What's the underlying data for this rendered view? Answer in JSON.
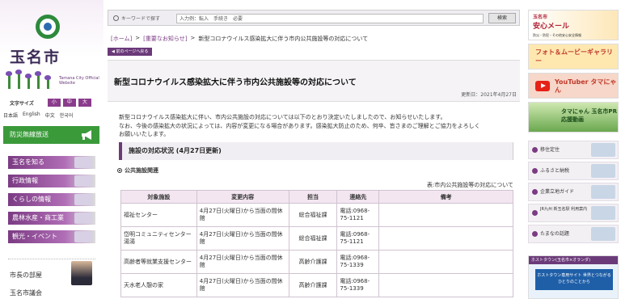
{
  "brand": {
    "city_name": "玉名市",
    "city_en": "Tamana City Official Website",
    "color_primary": "#6b3a79",
    "color_green": "#3a9a3a"
  },
  "left": {
    "font_size_label": "文字サイズ",
    "font_sizes": [
      "小",
      "中",
      "大"
    ],
    "languages": [
      "日本語",
      "English",
      "中文",
      "한국어"
    ],
    "bousai": "防災無線放送",
    "nav": [
      "玉名を知る",
      "行政情報",
      "くらしの情報",
      "農林水産・商工業",
      "観光・イベント"
    ],
    "mayor": "市長の部屋",
    "gikai": "玉名市議会"
  },
  "search": {
    "label": "キーワードで探す",
    "value": "入力例：転入　手続き　必要",
    "button": "検索"
  },
  "breadcrumb": [
    "[ホーム]",
    ">",
    "[重要なお知らせ]",
    ">",
    "新型コロナウイルス感染拡大に伴う市内公共施設等の対応について"
  ],
  "back_label": "前のページへ戻る",
  "page": {
    "title": "新型コロナウイルス感染拡大に伴う市内公共施設等の対応について",
    "updated": "更新日：2021年4月27日",
    "intro": [
      "新型コロナウイルス感染拡大に伴い、市内公共施設の対応については以下のとおり決定いたしましたので、お知らせいたします。",
      "なお、今後の感染拡大の状況によっては、内容が変更になる場合があります。感染拡大防止のため、何卒、皆さまのご理解とご協力をよろしく",
      "お願いいたします。"
    ],
    "section_heading": "施設の対応状況 (4月27日更新)",
    "subsection": "公共施設関連",
    "table_caption": "表:市内公共施設等の対応について"
  },
  "table": {
    "headers": [
      "対象施設",
      "変更内容",
      "担当",
      "連絡先",
      "備考"
    ],
    "rows": [
      {
        "facility": "福祉センター",
        "change": "4月27日(火曜日)から当面の間休館",
        "dept": "総合福祉課",
        "contact": "電話:0968-75-1121",
        "note": ""
      },
      {
        "facility": "岱明コミュニティセンター湯湯",
        "change": "4月27日(火曜日)から当面の間休館",
        "dept": "総合福祉課",
        "contact": "電話:0968-75-1121",
        "note": ""
      },
      {
        "facility": "高齢者等就業支援センター",
        "change": "4月27日(火曜日)から当面の間休館",
        "dept": "高齢介護課",
        "contact": "電話:0968-75-1339",
        "note": ""
      },
      {
        "facility": "天水老人憩の家",
        "change": "4月27日(火曜日)から当面の間休館",
        "dept": "高齢介護課",
        "contact": "電話:0968-75-1339",
        "note": ""
      }
    ]
  },
  "right": {
    "banner1_small": "玉名市",
    "banner1_title": "安心メール",
    "banner1_sub": "防災・防犯・その他安心安全情報",
    "banner2": "フォト＆ムービーギャラリー",
    "banner3": "YouTuber タマにゃん",
    "banner4": "タマにゃん 玉名市PR 応援動画",
    "side_nav": [
      "移住定住",
      "ふるさと納税",
      "企業立地ガイド",
      "JR九州 新玉名駅 利用案内",
      "たまなの話題"
    ],
    "bottom_header": "ホストタウン(玉名市×オランダ)",
    "bottom_text": "ホストタウン専用サイト 世界とつながるひとりのことから"
  }
}
